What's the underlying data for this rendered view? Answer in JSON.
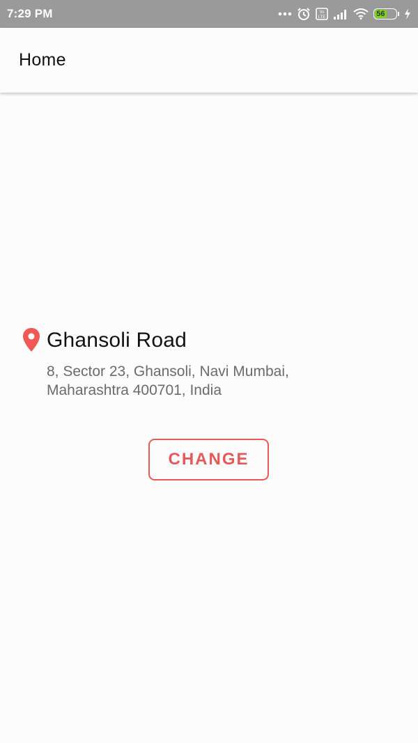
{
  "status_bar": {
    "time": "7:29 PM",
    "battery_level": "56",
    "icons": [
      "more-dots-icon",
      "alarm-icon",
      "volte-icon",
      "signal-icon",
      "wifi-icon",
      "battery-icon",
      "charging-icon"
    ],
    "volte_label": "Vo\nLTE"
  },
  "app_bar": {
    "title": "Home"
  },
  "location": {
    "icon": "location-pin-icon",
    "name": "Ghansoli Road",
    "address": "8, Sector 23, Ghansoli, Navi Mumbai, Maharashtra 400701, India"
  },
  "actions": {
    "change_label": "CHANGE"
  },
  "colors": {
    "accent": "#e95757",
    "status_bar": "#9a9a9a",
    "battery": "#7ed321"
  }
}
